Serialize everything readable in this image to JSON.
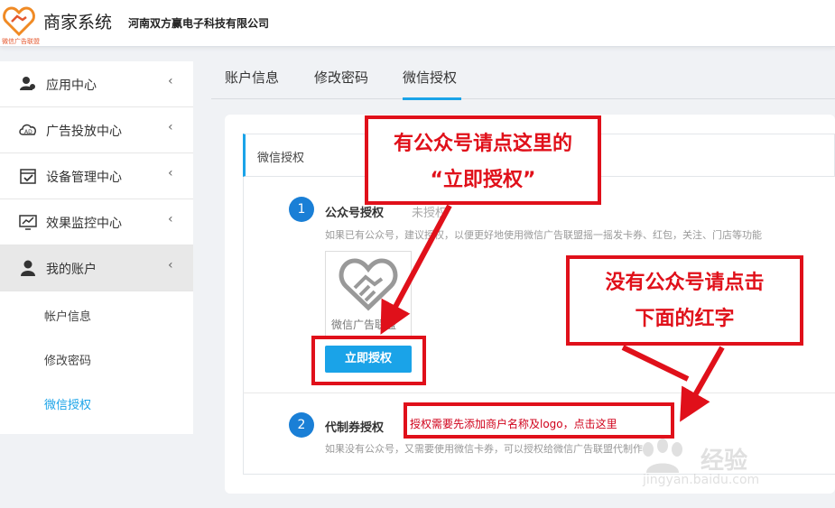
{
  "header": {
    "title": "商家系统",
    "company": "河南双方赢电子科技有限公司",
    "logo_text": "微信广告联盟"
  },
  "sidebar": {
    "items": [
      {
        "label": "应用中心",
        "icon": "user-group-icon"
      },
      {
        "label": "广告投放中心",
        "icon": "ad-cloud-icon"
      },
      {
        "label": "设备管理中心",
        "icon": "device-check-icon"
      },
      {
        "label": "效果监控中心",
        "icon": "monitor-chart-icon"
      },
      {
        "label": "我的账户",
        "icon": "user-icon"
      }
    ],
    "sub_items": [
      "帐户信息",
      "修改密码",
      "微信授权"
    ],
    "arrow": "‹"
  },
  "tabs": [
    "账户信息",
    "修改密码",
    "微信授权"
  ],
  "panel": {
    "title": "微信授权",
    "step1": {
      "num": "1",
      "title": "公众号授权",
      "status": "未授权",
      "desc": "如果已有公众号，建议授权，以便更好地使用微信广告联盟摇一摇发卡券、红包，关注、门店等功能",
      "qr_caption": "微信广告联盟",
      "button": "立即授权"
    },
    "step2": {
      "num": "2",
      "title": "代制券授权",
      "link": "授权需要先添加商户名称及logo，点击这里",
      "desc": "如果没有公众号，又需要使用微信卡券，可以授权给微信广告联盟代制作"
    }
  },
  "annotations": {
    "box1_line1": "有公众号请点这里的",
    "box1_line2": "“立即授权”",
    "box2_line1": "没有公众号请点击",
    "box2_line2": "下面的红字"
  },
  "watermark": {
    "text": "经验",
    "url": "jingyan.baidu.com"
  },
  "colors": {
    "accent": "#1aa3e8",
    "annotation_red": "#e0101a",
    "step_blue": "#1a7fd6"
  }
}
